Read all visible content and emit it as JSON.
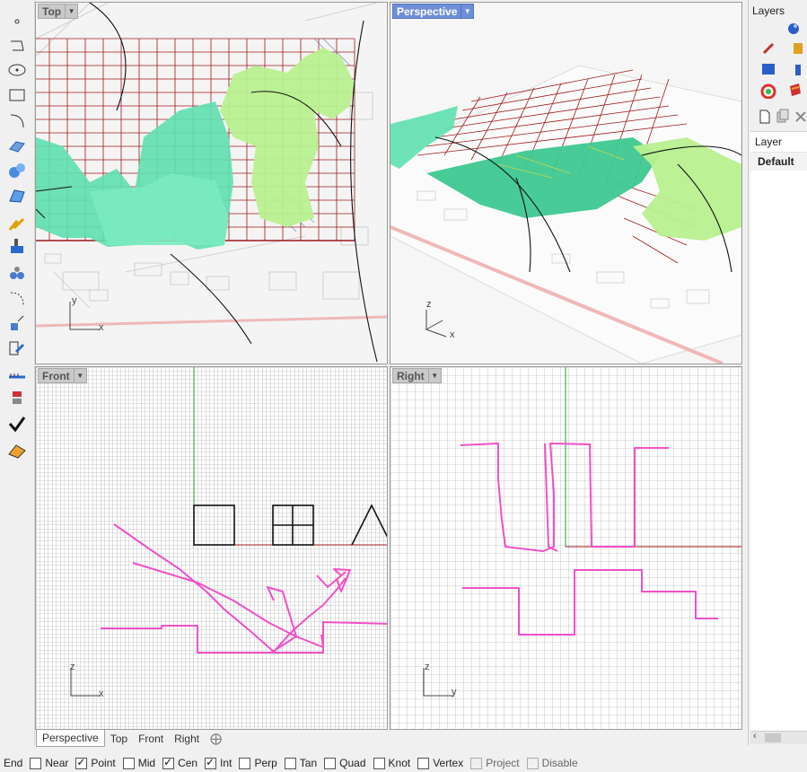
{
  "viewports": {
    "top": {
      "label": "Top"
    },
    "perspective": {
      "label": "Perspective"
    },
    "front": {
      "label": "Front"
    },
    "right": {
      "label": "Right"
    }
  },
  "axes": {
    "top": {
      "v": "y",
      "h": "x"
    },
    "perspective": {
      "v": "z",
      "h": "x"
    },
    "front": {
      "v": "z",
      "h": "x"
    },
    "right": {
      "v": "z",
      "h": "y"
    }
  },
  "panel": {
    "title": "Layers",
    "column_header": "Layer",
    "layers": [
      "Default"
    ]
  },
  "tabs": [
    "Perspective",
    "Top",
    "Front",
    "Right"
  ],
  "tabs_add_icon": "plus-icon",
  "osnap_prefix": "End",
  "osnaps": [
    {
      "label": "Near",
      "checked": false
    },
    {
      "label": "Point",
      "checked": true
    },
    {
      "label": "Mid",
      "checked": false
    },
    {
      "label": "Cen",
      "checked": true
    },
    {
      "label": "Int",
      "checked": true
    },
    {
      "label": "Perp",
      "checked": false
    },
    {
      "label": "Tan",
      "checked": false
    },
    {
      "label": "Quad",
      "checked": false
    },
    {
      "label": "Knot",
      "checked": false
    },
    {
      "label": "Vertex",
      "checked": false
    },
    {
      "label": "Project",
      "checked": false,
      "disabled": true
    },
    {
      "label": "Disable",
      "checked": false,
      "disabled": true
    }
  ],
  "colors": {
    "active_viewport": "#6f8ed8",
    "curve_pink": "#f050c8",
    "grid_red": "#a01818",
    "mesh_teal": "#5fe0b0",
    "mesh_green": "#b8f090"
  }
}
